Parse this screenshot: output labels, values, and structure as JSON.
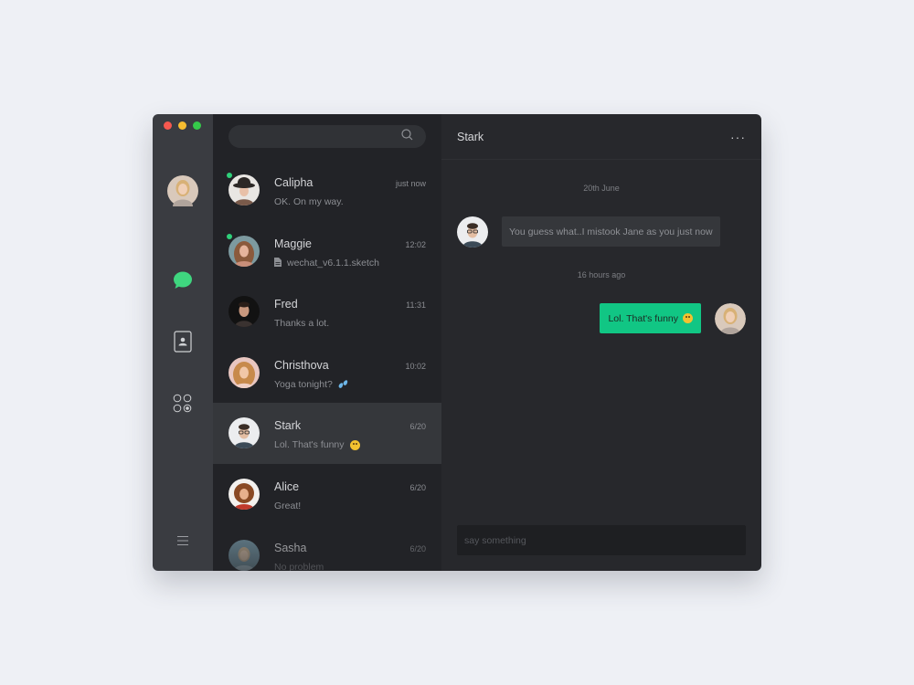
{
  "window": {
    "traffic_lights": [
      "#f6584f",
      "#f7bd30",
      "#35c94a"
    ]
  },
  "sidebar": {
    "nav": [
      {
        "icon": "chat-bubble-icon",
        "color": "#3fd67f"
      },
      {
        "icon": "contacts-icon",
        "color": "#cfd1d4"
      },
      {
        "icon": "apps-grid-icon",
        "color": "#cfd1d4"
      },
      {
        "icon": "menu-icon",
        "color": "#9c9ea3"
      }
    ]
  },
  "search": {
    "placeholder": "",
    "icon": "search-icon"
  },
  "conversations": [
    {
      "name": "Calipha",
      "time": "just now",
      "preview": "OK. On my way.",
      "online": true
    },
    {
      "name": "Maggie",
      "time": "12:02",
      "preview": "wechat_v6.1.1.sketch",
      "preview_icon": "file-icon",
      "online": true
    },
    {
      "name": "Fred",
      "time": "11:31",
      "preview": "Thanks a lot.",
      "online": false
    },
    {
      "name": "Christhova",
      "time": "10:02",
      "preview": "Yoga tonight?",
      "preview_icon": "sweat-drops-emoji",
      "online": false
    },
    {
      "name": "Stark",
      "time": "6/20",
      "preview": "Lol. That's funny",
      "preview_icon": "laughing-emoji",
      "online": false,
      "active": true
    },
    {
      "name": "Alice",
      "time": "6/20",
      "preview": "Great!",
      "online": false
    },
    {
      "name": "Sasha",
      "time": "6/20",
      "preview": "No problem",
      "online": false
    }
  ],
  "chat": {
    "title": "Stark",
    "more_label": "···",
    "separators": [
      "20th June",
      "16 hours ago"
    ],
    "incoming_text": "You guess what..I mistook Jane as you just now",
    "outgoing_text": "Lol. That's funny",
    "composer_placeholder": "say something"
  }
}
